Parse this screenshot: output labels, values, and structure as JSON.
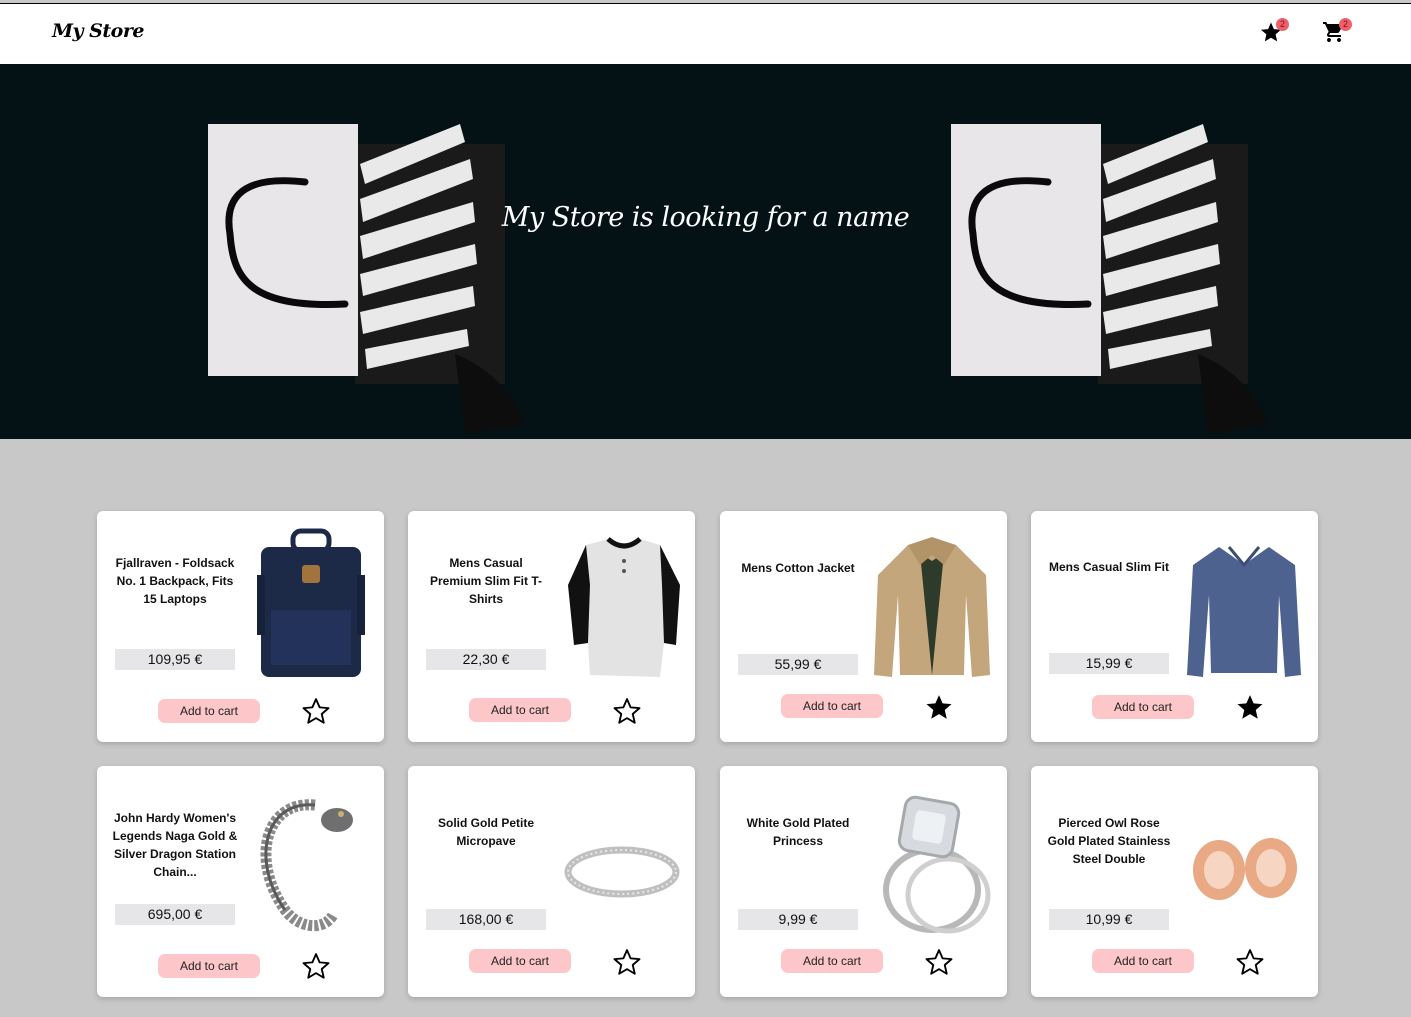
{
  "header": {
    "logo": "My Store",
    "favorites_count": "2",
    "cart_count": "2",
    "favorites_icon": "star-icon",
    "cart_icon": "cart-icon"
  },
  "hero": {
    "title": "My Store is looking for a name"
  },
  "products": [
    {
      "name": "Fjallraven - Foldsack No. 1 Backpack, Fits 15 Laptops",
      "price": "109,95 €",
      "button": "Add to cart",
      "favorite": false,
      "image": "backpack"
    },
    {
      "name": "Mens Casual Premium Slim Fit T-Shirts",
      "price": "22,30 €",
      "button": "Add to cart",
      "favorite": false,
      "image": "tshirt"
    },
    {
      "name": "Mens Cotton Jacket",
      "price": "55,99 €",
      "button": "Add to cart",
      "favorite": true,
      "image": "jacket"
    },
    {
      "name": "Mens Casual Slim Fit",
      "price": "15,99 €",
      "button": "Add to cart",
      "favorite": true,
      "image": "sweater"
    },
    {
      "name": "John Hardy Women's Legends Naga Gold & Silver Dragon Station Chain...",
      "price": "695,00 €",
      "button": "Add to cart",
      "favorite": false,
      "image": "bracelet"
    },
    {
      "name": "Solid Gold Petite Micropave",
      "price": "168,00 €",
      "button": "Add to cart",
      "favorite": false,
      "image": "ring"
    },
    {
      "name": "White Gold Plated Princess",
      "price": "9,99 €",
      "button": "Add to cart",
      "favorite": false,
      "image": "diamond-ring"
    },
    {
      "name": "Pierced Owl Rose Gold Plated Stainless Steel Double",
      "price": "10,99 €",
      "button": "Add to cart",
      "favorite": false,
      "image": "plugs"
    }
  ]
}
